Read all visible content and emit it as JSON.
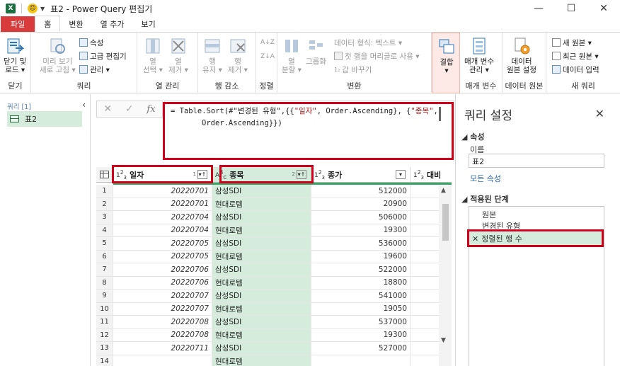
{
  "window": {
    "title": "표2 - Power Query 편집기",
    "app_icon": "X"
  },
  "tabs": [
    {
      "label": "파일"
    },
    {
      "label": "홈"
    },
    {
      "label": "변환"
    },
    {
      "label": "열 추가"
    },
    {
      "label": "보기"
    }
  ],
  "ribbon": {
    "close_group": {
      "btn_line1": "닫기 및",
      "btn_line2": "로드 ▾",
      "label": "닫기"
    },
    "query_group": {
      "preview_line1": "미리 보기",
      "preview_line2": "새로 고침 ▾",
      "properties": "속성",
      "advanced_editor": "고급 편집기",
      "manage": "관리 ▾",
      "label": "쿼리"
    },
    "columns_group": {
      "select_line1": "열",
      "select_line2": "선택 ▾",
      "remove_line1": "열",
      "remove_line2": "제거 ▾",
      "label": "열 관리"
    },
    "rows_group": {
      "keep_line1": "행",
      "keep_line2": "유지 ▾",
      "remove_line1": "행",
      "remove_line2": "제거 ▾",
      "label": "행 감소"
    },
    "sort_group": {
      "label": "정렬"
    },
    "transform_group": {
      "split_line1": "열",
      "split_line2": "분할 ▾",
      "groupby": "그룹화",
      "datatype": "데이터 형식: 텍스트 ▾",
      "first_row_header": "첫 행을 머리글로 사용 ▾",
      "replace_values": "값 바꾸기",
      "label": "변환"
    },
    "combine_group": {
      "btn_line1": "결합",
      "btn_line2": "▾"
    },
    "params_group": {
      "btn_line1": "매개 변수",
      "btn_line2": "관리 ▾",
      "label": "매개 변수"
    },
    "datasource_group": {
      "btn_line1": "데이터",
      "btn_line2": "원본 설정",
      "label": "데이터 원본"
    },
    "newquery_group": {
      "new_source": "새 원본 ▾",
      "recent_sources": "최근 원본 ▾",
      "enter_data": "데이터 입력",
      "label": "새 쿼리"
    }
  },
  "queries_panel": {
    "header": "쿼리 [1]",
    "items": [
      {
        "label": "표2"
      }
    ]
  },
  "formula": {
    "line1_a": "= Table.Sort(#\"변경된 유형\",{{",
    "line1_str1": "\"일자\"",
    "line1_b": ", Order.Ascending}, {",
    "line1_str2": "\"종목\"",
    "line1_c": ",",
    "line2": "Order.Ascending}})"
  },
  "grid": {
    "columns": [
      {
        "type": "1²3",
        "name": "일자",
        "sort_order": "1"
      },
      {
        "type": "A^B_C",
        "name": "종목",
        "sort_order": "2"
      },
      {
        "type": "1²3",
        "name": "종가"
      },
      {
        "type": "1²3",
        "name": "대비"
      }
    ],
    "rows": [
      {
        "n": "1",
        "date": "20220701",
        "stock": "삼성SDI",
        "price": "512000"
      },
      {
        "n": "2",
        "date": "20220701",
        "stock": "현대로템",
        "price": "20900"
      },
      {
        "n": "3",
        "date": "20220704",
        "stock": "삼성SDI",
        "price": "506000"
      },
      {
        "n": "4",
        "date": "20220704",
        "stock": "현대로템",
        "price": "19300"
      },
      {
        "n": "5",
        "date": "20220705",
        "stock": "삼성SDI",
        "price": "536000"
      },
      {
        "n": "6",
        "date": "20220705",
        "stock": "현대로템",
        "price": "19600"
      },
      {
        "n": "7",
        "date": "20220706",
        "stock": "삼성SDI",
        "price": "522000"
      },
      {
        "n": "8",
        "date": "20220706",
        "stock": "현대로템",
        "price": "18800"
      },
      {
        "n": "9",
        "date": "20220707",
        "stock": "삼성SDI",
        "price": "541000"
      },
      {
        "n": "10",
        "date": "20220707",
        "stock": "현대로템",
        "price": "19050"
      },
      {
        "n": "11",
        "date": "20220708",
        "stock": "삼성SDI",
        "price": "537000"
      },
      {
        "n": "12",
        "date": "20220708",
        "stock": "현대로템",
        "price": "19300"
      },
      {
        "n": "13",
        "date": "20220711",
        "stock": "삼성SDI",
        "price": "527000"
      },
      {
        "n": "14",
        "date": "",
        "stock": "현대로템",
        "price": ""
      }
    ]
  },
  "settings_panel": {
    "title": "쿼리 설정",
    "properties_header": "속성",
    "name_label": "이름",
    "name_value": "표2",
    "all_properties": "모든 속성",
    "steps_header": "적용된 단계",
    "steps": [
      {
        "label": "원본"
      },
      {
        "label": "변경된 유형"
      },
      {
        "label": "정렬된 행 수"
      }
    ]
  }
}
